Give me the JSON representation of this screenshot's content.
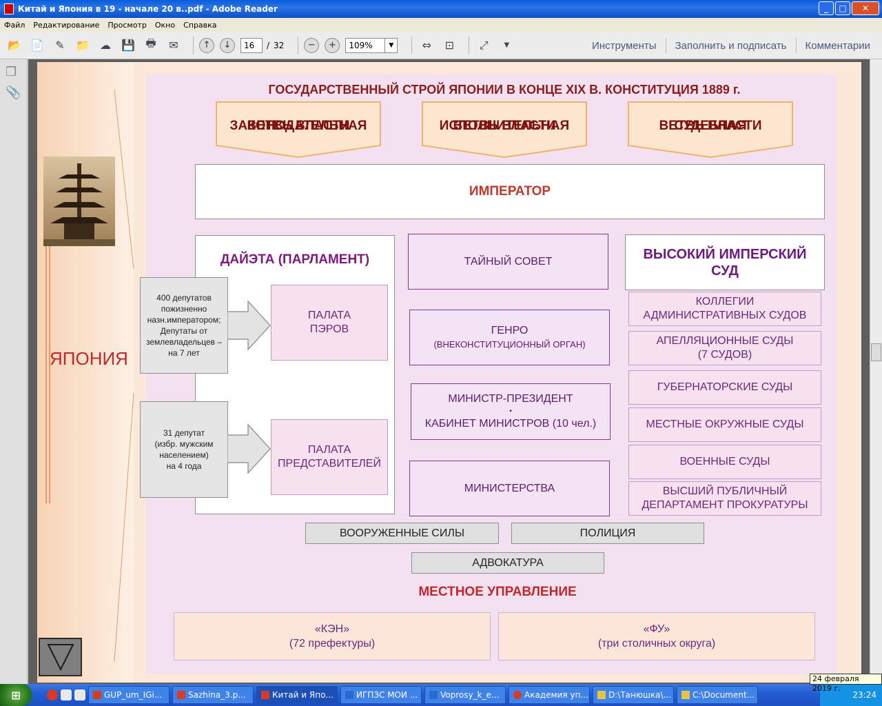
{
  "window": {
    "title": "Китай и Япония в 19 - начале 20 в..pdf - Adobe Reader",
    "min": "_",
    "max": "□",
    "close": "✕"
  },
  "menu": [
    "Файл",
    "Редактирование",
    "Просмотр",
    "Окно",
    "Справка"
  ],
  "toolbar": {
    "page_current": "16",
    "page_sep": "/",
    "page_total": "32",
    "zoom": "109%",
    "links": [
      "Инструменты",
      "Заполнить и подписать",
      "Комментарии"
    ]
  },
  "slide": {
    "side_label": "ЯПОНИЯ",
    "title": "ГОСУДАРСТВЕННЫЙ СТРОЙ ЯПОНИИ В КОНЦЕ XIX В. КОНСТИТУЦИЯ 1889 г.",
    "branches": [
      {
        "line1": "ЗАКОНОДАТЕЛЬНАЯ",
        "line2": "ВЕТВЬ ВЛАСТИ"
      },
      {
        "line1": "ИСПОЛНИТЕЛЬНАЯ",
        "line2": "ВЕТВЬ ВЛАСТИ"
      },
      {
        "line1": "СУДЕБНАЯ",
        "line2": "ВЕТВЬ ВЛАСТИ"
      }
    ],
    "emperor": "ИМПЕРАТОР",
    "diet": {
      "title": "ДАЙЭТА (ПАРЛАМЕНТ)",
      "peers_note": [
        "400 депутатов",
        "пожизненно",
        "назн.императором;",
        "Депутаты от",
        "землевладельцев –",
        "на 7 лет"
      ],
      "peers": [
        "ПАЛАТА",
        "ПЭРОВ"
      ],
      "reps_note": [
        "31 депутат",
        "(избр. мужским",
        "населением)",
        "на 4 года"
      ],
      "reps": [
        "ПАЛАТА",
        "ПРЕДСТАВИТЕЛЕЙ"
      ]
    },
    "executive": {
      "privy_council": "ТАЙНЫЙ СОВЕТ",
      "genro": "ГЕНРО",
      "genro_note": "(ВНЕКОНСТИТУЦИОННЫЙ ОРГАН)",
      "pm": "МИНИСТР-ПРЕЗИДЕНТ",
      "pm_dot": "▪",
      "cabinet": "КАБИНЕТ МИНИСТРОВ (10 чел.)",
      "ministries": "МИНИСТЕРСТВА"
    },
    "judicial": {
      "high_court": [
        "ВЫСОКИЙ ИМПЕРСКИЙ",
        "СУД"
      ],
      "courts": [
        [
          "КОЛЛЕГИИ",
          "АДМИНИСТРАТИВНЫХ СУДОВ"
        ],
        [
          "АПЕЛЛЯЦИОННЫЕ СУДЫ",
          "(7 СУДОВ)"
        ],
        [
          "ГУБЕРНАТОРСКИЕ СУДЫ"
        ],
        [
          "МЕСТНЫЕ ОКРУЖНЫЕ СУДЫ"
        ],
        [
          "ВОЕННЫЕ СУДЫ"
        ],
        [
          "ВЫСШИЙ ПУБЛИЧНЫЙ",
          "ДЕПАРТАМЕНТ ПРОКУРАТУРЫ"
        ]
      ]
    },
    "armed_forces": "ВООРУЖЕННЫЕ СИЛЫ",
    "police": "ПОЛИЦИЯ",
    "bar": "АДВОКАТУРА",
    "local_title": "МЕСТНОЕ УПРАВЛЕНИЕ",
    "ken": [
      "«КЭН»",
      "(72 префектуры)"
    ],
    "fu": [
      "«ФУ»",
      "(три столичных округа)"
    ]
  },
  "taskbar": {
    "tasks": [
      "GUP_um_IGi...",
      "Sazhina_3.p...",
      "Китай и Япо...",
      "ИГПЗС МОИ ...",
      "Voprosy_k_e...",
      "Академия уп...",
      "D:\\Танюшка\\...",
      "C:\\Document..."
    ],
    "date_tooltip": "24 февраля 2019 г.",
    "time": "23:24"
  }
}
